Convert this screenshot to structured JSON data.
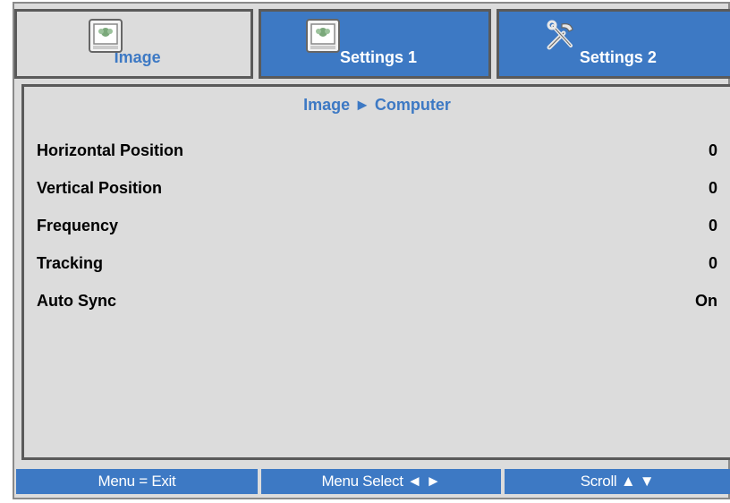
{
  "tabs": [
    {
      "label": "Image",
      "icon": "image-icon"
    },
    {
      "label": "Settings 1",
      "icon": "image-icon"
    },
    {
      "label": "Settings 2",
      "icon": "tools-icon"
    }
  ],
  "breadcrumb": "Image ► Computer",
  "rows": [
    {
      "label": "Horizontal Position",
      "value": "0"
    },
    {
      "label": "Vertical Position",
      "value": "0"
    },
    {
      "label": "Frequency",
      "value": "0"
    },
    {
      "label": "Tracking",
      "value": "0"
    },
    {
      "label": "Auto Sync",
      "value": "On"
    }
  ],
  "footer": {
    "exit": "Menu = Exit",
    "select": "Menu Select ◄ ►",
    "scroll": "Scroll ▲ ▼"
  },
  "colors": {
    "accent": "#3d79c4",
    "panel": "#dcdcdc",
    "border": "#5a5a5a"
  }
}
